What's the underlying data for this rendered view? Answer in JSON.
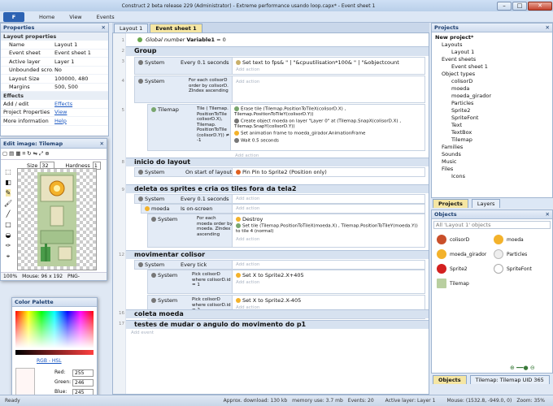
{
  "window": {
    "title": "Construct 2 beta release 229 (Administrator) - Extreme performance usando loop.capx* - Event sheet 1",
    "min": "–",
    "max": "□",
    "close": "✕"
  },
  "ribbon": {
    "file": "F",
    "tabs": [
      "Home",
      "View",
      "Events"
    ]
  },
  "properties": {
    "title": "Properties",
    "section_layout": "Layout properties",
    "rows": [
      {
        "k": "Name",
        "v": "Layout 1"
      },
      {
        "k": "Event sheet",
        "v": "Event sheet 1"
      },
      {
        "k": "Active layer",
        "v": "Layer 1"
      },
      {
        "k": "Unbounded scro...",
        "v": "No"
      },
      {
        "k": "Layout Size",
        "v": "100000, 480"
      },
      {
        "k": "Margins",
        "v": "500, 500"
      }
    ],
    "section_effects": "Effects",
    "links": [
      {
        "k": "Add / edit",
        "v": "Effects"
      },
      {
        "k": "Project Properties",
        "v": "View"
      },
      {
        "k": "More information",
        "v": "Help"
      }
    ]
  },
  "image_editor": {
    "title": "Edit image: Tilemap",
    "size_label": "Size",
    "size_value": "32",
    "hardness_label": "Hardness",
    "hardness_value": "1",
    "zoom": "100%",
    "mouse": "Mouse: 96 x 192",
    "format": "PNG-"
  },
  "palette": {
    "title": "Color Palette",
    "mode": "RGB - HSL",
    "red_label": "Red:",
    "red": "255",
    "green_label": "Green:",
    "green": "246",
    "blue_label": "Blue:",
    "blue": "245"
  },
  "tabs": {
    "layout": "Layout 1",
    "sheet": "Event sheet 1"
  },
  "sheet": {
    "global": {
      "label": "Global number",
      "name": "Variable1",
      "value": "= 0"
    },
    "groups": [
      {
        "title": "Group",
        "line": "2"
      },
      {
        "title": "inicio do layout",
        "line": "8"
      },
      {
        "title": "deleta os sprites e cria os tiles fora da tela2",
        "line": "9"
      },
      {
        "title": "movimentar colisor",
        "line": "12"
      },
      {
        "title": "coleta moeda",
        "line": "16"
      },
      {
        "title": "testes de mudar o angulo do movimento do p1",
        "line": "17"
      }
    ],
    "add_action": "Add action",
    "add_event": "Add event",
    "ev3": {
      "obj": "System",
      "cond": "Every 0.1 seconds",
      "act": "Set text to fps& \" | \"&cpuutilisation*100& \" | \"&objectcount"
    },
    "ev4": {
      "obj": "System",
      "cond": "For each colisorD order by colisorD. ZIndex ascending"
    },
    "ev5": {
      "obj": "Tilemap",
      "cond": "Tile ( Tilemap. PositionToTile colisorD.X), Tilemap. PositionToTile (colisorD.Y)) ≠ -1",
      "a1": "Erase tile (Tilemap.PositionToTileX(colisorD.X) , Tilemap.PositionToTileY(colisorD.Y))",
      "a2": "Create object moeda on layer \"Layer 0\" at (Tilemap.SnapX(colisorD.X) , Tilemap.SnapY(colisorD.Y))",
      "a3": "Set animation frame to moeda_girador.AnimationFrame",
      "a4": "Wait 0.5 seconds"
    },
    "ev8": {
      "obj": "System",
      "cond": "On start of layout",
      "act": "Pin Pin to Sprite2 (Position only)"
    },
    "ev10": {
      "obj": "System",
      "cond": "Every 0.1 seconds"
    },
    "ev11": {
      "obj": "moeda",
      "cond": "Is on-screen"
    },
    "ev12": {
      "obj": "System",
      "cond": "For each moeda order by moeda. ZIndex ascending",
      "a1": "Destroy",
      "a2": "Set tile (Tilemap.PositionToTileX(moeda.X) , Tilemap.PositionToTileY(moeda.Y)) to tile 4 (normal)"
    },
    "ev13": {
      "obj": "System",
      "cond": "Every tick"
    },
    "ev14": {
      "obj": "System",
      "cond": "Pick colisorD where colisorD.id = 1",
      "act": "Set X to Sprite2.X+405"
    },
    "ev15": {
      "obj": "System",
      "cond": "Pick colisorD where colisorD.id = 2",
      "act": "Set X to Sprite2.X-405"
    }
  },
  "projects": {
    "title": "Projects",
    "items": [
      "New project*",
      "Layouts",
      "Layout 1",
      "Event sheets",
      "Event sheet 1",
      "Object types",
      "colisorD",
      "moeda",
      "moeda_girador",
      "Particles",
      "Sprite2",
      "SpriteFont",
      "Text",
      "TextBox",
      "Tilemap",
      "Families",
      "Sounds",
      "Music",
      "Files",
      "Icons"
    ],
    "tabs": [
      "Projects",
      "Layers"
    ]
  },
  "objects": {
    "title": "Objects",
    "filter": "All 'Layout 1' objects",
    "items": [
      "colisorD",
      "moeda",
      "moeda_girador",
      "Particles",
      "Sprite2",
      "SpriteFont",
      "Tilemap"
    ],
    "tabs": [
      "Objects",
      "Tilemap: Tilemap UID 365"
    ]
  },
  "status": {
    "ready": "Ready",
    "download": "Approx. download: 130 kb",
    "memory": "memory use: 3.7 mb",
    "events": "Events: 20",
    "layer": "Active layer: Layer 1",
    "mouse": "Mouse: (1532.8, -949.0, 0)",
    "zoom": "Zoom: 35%"
  },
  "colors": {
    "accent": "#2d63b3",
    "group_bg": "#d7e2f0",
    "condition_bg": "#e3ebf6"
  }
}
